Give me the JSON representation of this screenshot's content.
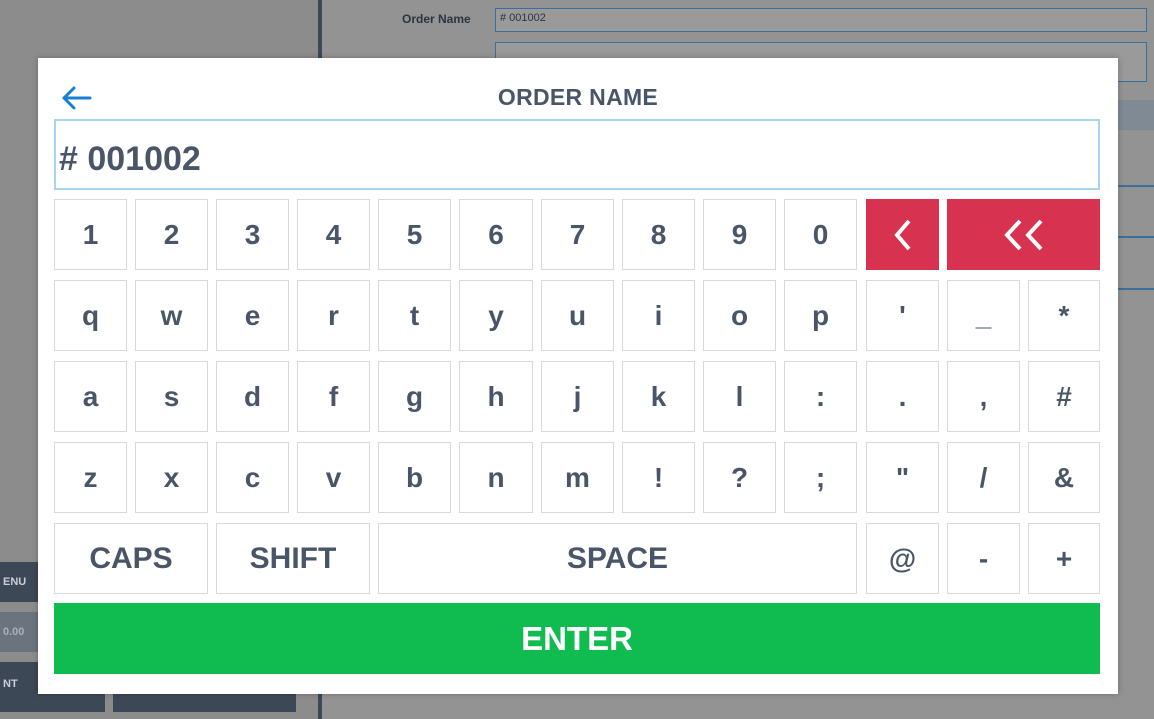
{
  "background": {
    "order_name_label": "Order Name",
    "order_name_value": "# 001002",
    "buttons": [
      "ENU",
      "0.00",
      "NT"
    ]
  },
  "keyboard_dialog": {
    "title": "ORDER NAME",
    "input_value": "# 001002",
    "rows": [
      [
        "1",
        "2",
        "3",
        "4",
        "5",
        "6",
        "7",
        "8",
        "9",
        "0"
      ],
      [
        "q",
        "w",
        "e",
        "r",
        "t",
        "y",
        "u",
        "i",
        "o",
        "p",
        "'",
        "_",
        "*"
      ],
      [
        "a",
        "s",
        "d",
        "f",
        "g",
        "h",
        "j",
        "k",
        "l",
        ":",
        ".",
        ",",
        "#"
      ],
      [
        "z",
        "x",
        "c",
        "v",
        "b",
        "n",
        "m",
        "!",
        "?",
        ";",
        "\"",
        "/",
        "&"
      ]
    ],
    "bottom_row": {
      "caps": "CAPS",
      "shift": "SHIFT",
      "space": "SPACE",
      "keys": [
        "@",
        "-",
        "+"
      ]
    },
    "enter_label": "ENTER",
    "colors": {
      "backspace": "#d7324f",
      "enter": "#10bb4f",
      "text": "#4a5668",
      "border": "#d7d9dc"
    }
  }
}
